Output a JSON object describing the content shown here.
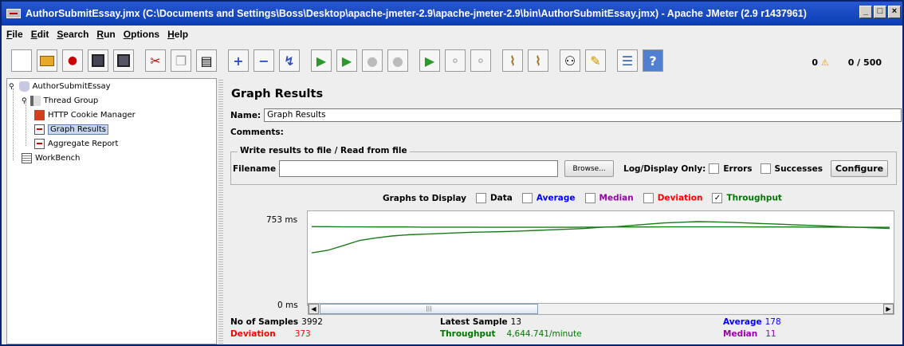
{
  "window": {
    "title": "AuthorSubmitEssay.jmx (C:\\Documents and Settings\\Boss\\Desktop\\apache-jmeter-2.9\\apache-jmeter-2.9\\bin\\AuthorSubmitEssay.jmx) - Apache JMeter (2.9 r1437961)"
  },
  "menu": [
    "File",
    "Edit",
    "Search",
    "Run",
    "Options",
    "Help"
  ],
  "toolbar": {
    "icons": [
      "new-icon",
      "open-icon",
      "templates-icon",
      "save-icon",
      "save-as-icon",
      "cut-icon",
      "copy-icon",
      "paste-icon",
      "expand-icon",
      "collapse-icon",
      "toggle-icon",
      "start-icon",
      "start-no-timers-icon",
      "stop-icon",
      "shutdown-icon",
      "remote-start-icon",
      "remote-stop-icon",
      "remote-shutdown-icon",
      "clear-icon",
      "clear-all-icon",
      "search-icon",
      "reset-search-icon",
      "function-helper-icon",
      "help-icon"
    ],
    "warnings": "0",
    "threads": "0 / 500"
  },
  "tree": {
    "items": [
      {
        "label": "AuthorSubmitEssay",
        "icon": "test-plan-icon"
      },
      {
        "label": "Thread Group",
        "icon": "thread-group-icon"
      },
      {
        "label": "HTTP Cookie Manager",
        "icon": "cookie-manager-icon"
      },
      {
        "label": "Graph Results",
        "icon": "graph-results-icon"
      },
      {
        "label": "Aggregate Report",
        "icon": "aggregate-report-icon"
      },
      {
        "label": "WorkBench",
        "icon": "workbench-icon"
      }
    ]
  },
  "panel": {
    "title": "Graph Results",
    "name_label": "Name:",
    "name_value": "Graph Results",
    "comments_label": "Comments:",
    "group_title": "Write results to file / Read from file",
    "filename_label": "Filename",
    "filename_value": "",
    "browse_label": "Browse...",
    "log_display_label": "Log/Display Only:",
    "errors_label": "Errors",
    "successes_label": "Successes",
    "configure_label": "Configure"
  },
  "graph_options": {
    "label": "Graphs to Display",
    "options": [
      {
        "label": "Data",
        "checked": false,
        "color": "#000000"
      },
      {
        "label": "Average",
        "checked": false,
        "color": "#0000ff"
      },
      {
        "label": "Median",
        "checked": false,
        "color": "#9900aa"
      },
      {
        "label": "Deviation",
        "checked": false,
        "color": "#ff0000"
      },
      {
        "label": "Throughput",
        "checked": true,
        "color": "#007700"
      }
    ]
  },
  "chart_data": {
    "type": "line",
    "ylim": [
      0,
      753
    ],
    "y_tick_labels": [
      "753 ms",
      "0 ms"
    ],
    "series": [
      {
        "color": "#1a7a1a",
        "values": [
          420,
          440,
          480,
          520,
          540,
          555,
          565,
          570,
          575,
          580,
          585,
          588,
          590,
          595,
          600,
          605,
          610,
          615,
          625,
          630,
          640,
          650,
          660,
          665,
          670,
          668,
          665,
          660,
          655,
          650,
          645,
          640,
          635,
          630,
          625,
          620,
          615
        ]
      },
      {
        "color": "#1a7a1a",
        "values": [
          630,
          630,
          628,
          628,
          627,
          627,
          627,
          626,
          626,
          626,
          626,
          625,
          625,
          625,
          625,
          625,
          625,
          626,
          626,
          627,
          627,
          627,
          628,
          628,
          628,
          628,
          628,
          628,
          627,
          627,
          627,
          626,
          626,
          626,
          625,
          625,
          625
        ]
      }
    ]
  },
  "stats": {
    "samples_label": "No of Samples",
    "samples_value": "3992",
    "latest_label": "Latest Sample",
    "latest_value": "13",
    "average_label": "Average",
    "average_value": "178",
    "deviation_label": "Deviation",
    "deviation_value": "373",
    "throughput_label": "Throughput",
    "throughput_value": "4,644.741/minute",
    "median_label": "Median",
    "median_value": "11"
  }
}
